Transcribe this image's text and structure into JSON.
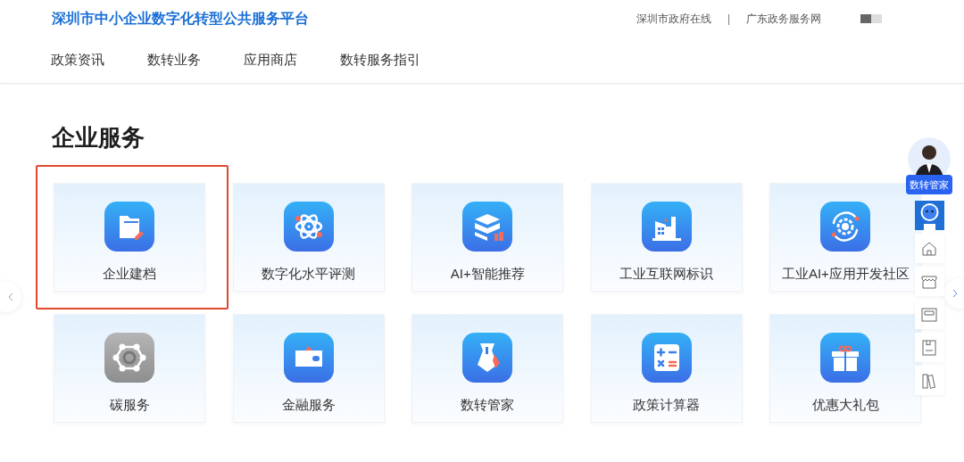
{
  "header": {
    "site_title": "深圳市中小企业数字化转型公共服务平台",
    "links": [
      "深圳市政府在线",
      "广东政务服务网"
    ],
    "separator": "|"
  },
  "nav": {
    "items": [
      {
        "label": "政策资讯"
      },
      {
        "label": "数转业务"
      },
      {
        "label": "应用商店"
      },
      {
        "label": "数转服务指引"
      }
    ]
  },
  "section": {
    "title": "企业服务",
    "cards": [
      {
        "label": "企业建档",
        "selected": true,
        "disabled": false
      },
      {
        "label": "数字化水平评测",
        "selected": false,
        "disabled": false
      },
      {
        "label": "AI+智能推荐",
        "selected": false,
        "disabled": false
      },
      {
        "label": "工业互联网标识",
        "selected": false,
        "disabled": false
      },
      {
        "label": "工业AI+应用开发社区",
        "selected": false,
        "disabled": false
      },
      {
        "label": "碳服务",
        "selected": false,
        "disabled": true
      },
      {
        "label": "金融服务",
        "selected": false,
        "disabled": false
      },
      {
        "label": "数转管家",
        "selected": false,
        "disabled": false
      },
      {
        "label": "政策计算器",
        "selected": false,
        "disabled": false
      },
      {
        "label": "优惠大礼包",
        "selected": false,
        "disabled": false
      }
    ]
  },
  "side_toolbar": {
    "assistant_label": "数转管家"
  }
}
